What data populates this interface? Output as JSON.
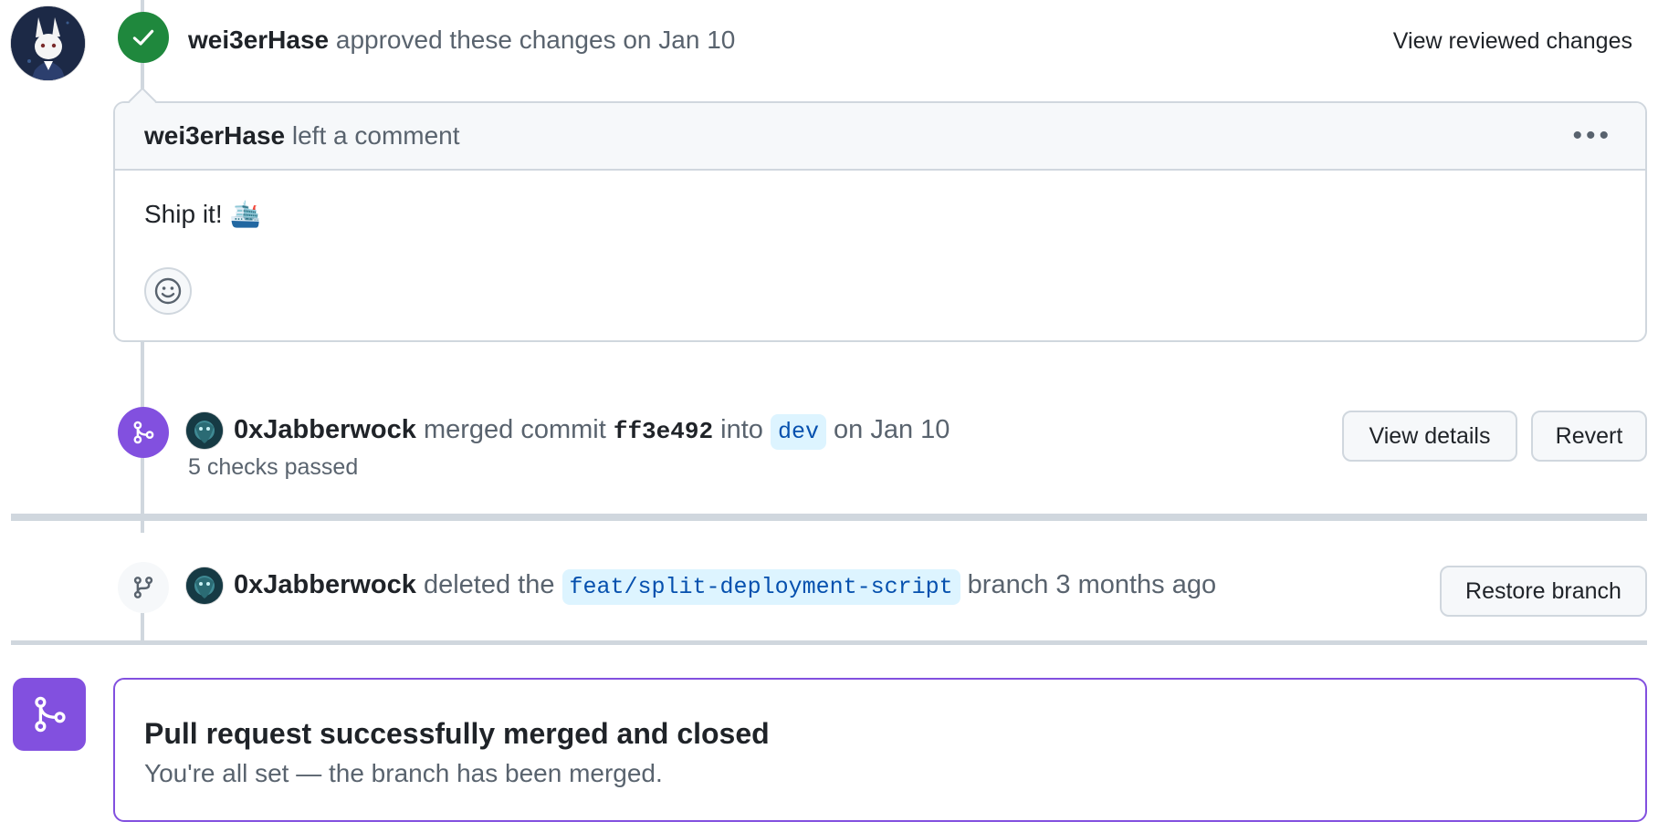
{
  "review": {
    "user": "wei3erHase",
    "action": "approved these changes on Jan 10",
    "view_link": "View reviewed changes"
  },
  "comment": {
    "user": "wei3erHase",
    "action": "left a comment",
    "menu": "•••",
    "body": "Ship it!",
    "body_emoji": "🛳️"
  },
  "merge_event": {
    "user": "0xJabberwock",
    "action": "merged commit",
    "commit": "ff3e492",
    "into": "into",
    "branch": "dev",
    "when": "on Jan 10",
    "checks": "5 checks passed",
    "view_details": "View details",
    "revert": "Revert"
  },
  "delete_event": {
    "user": "0xJabberwock",
    "action": "deleted the",
    "branch": "feat/split-deployment-script",
    "suffix": "branch 3 months ago",
    "restore": "Restore branch"
  },
  "merged_status": {
    "title": "Pull request successfully merged and closed",
    "subtitle": "You're all set — the branch has been merged."
  },
  "colors": {
    "approve": "#1f883d",
    "merged": "#8250df",
    "border": "#d0d7de",
    "muted": "#59636e"
  },
  "icons": [
    "check-icon",
    "kebab-icon",
    "smiley-icon",
    "git-merge-icon",
    "git-branch-icon"
  ]
}
